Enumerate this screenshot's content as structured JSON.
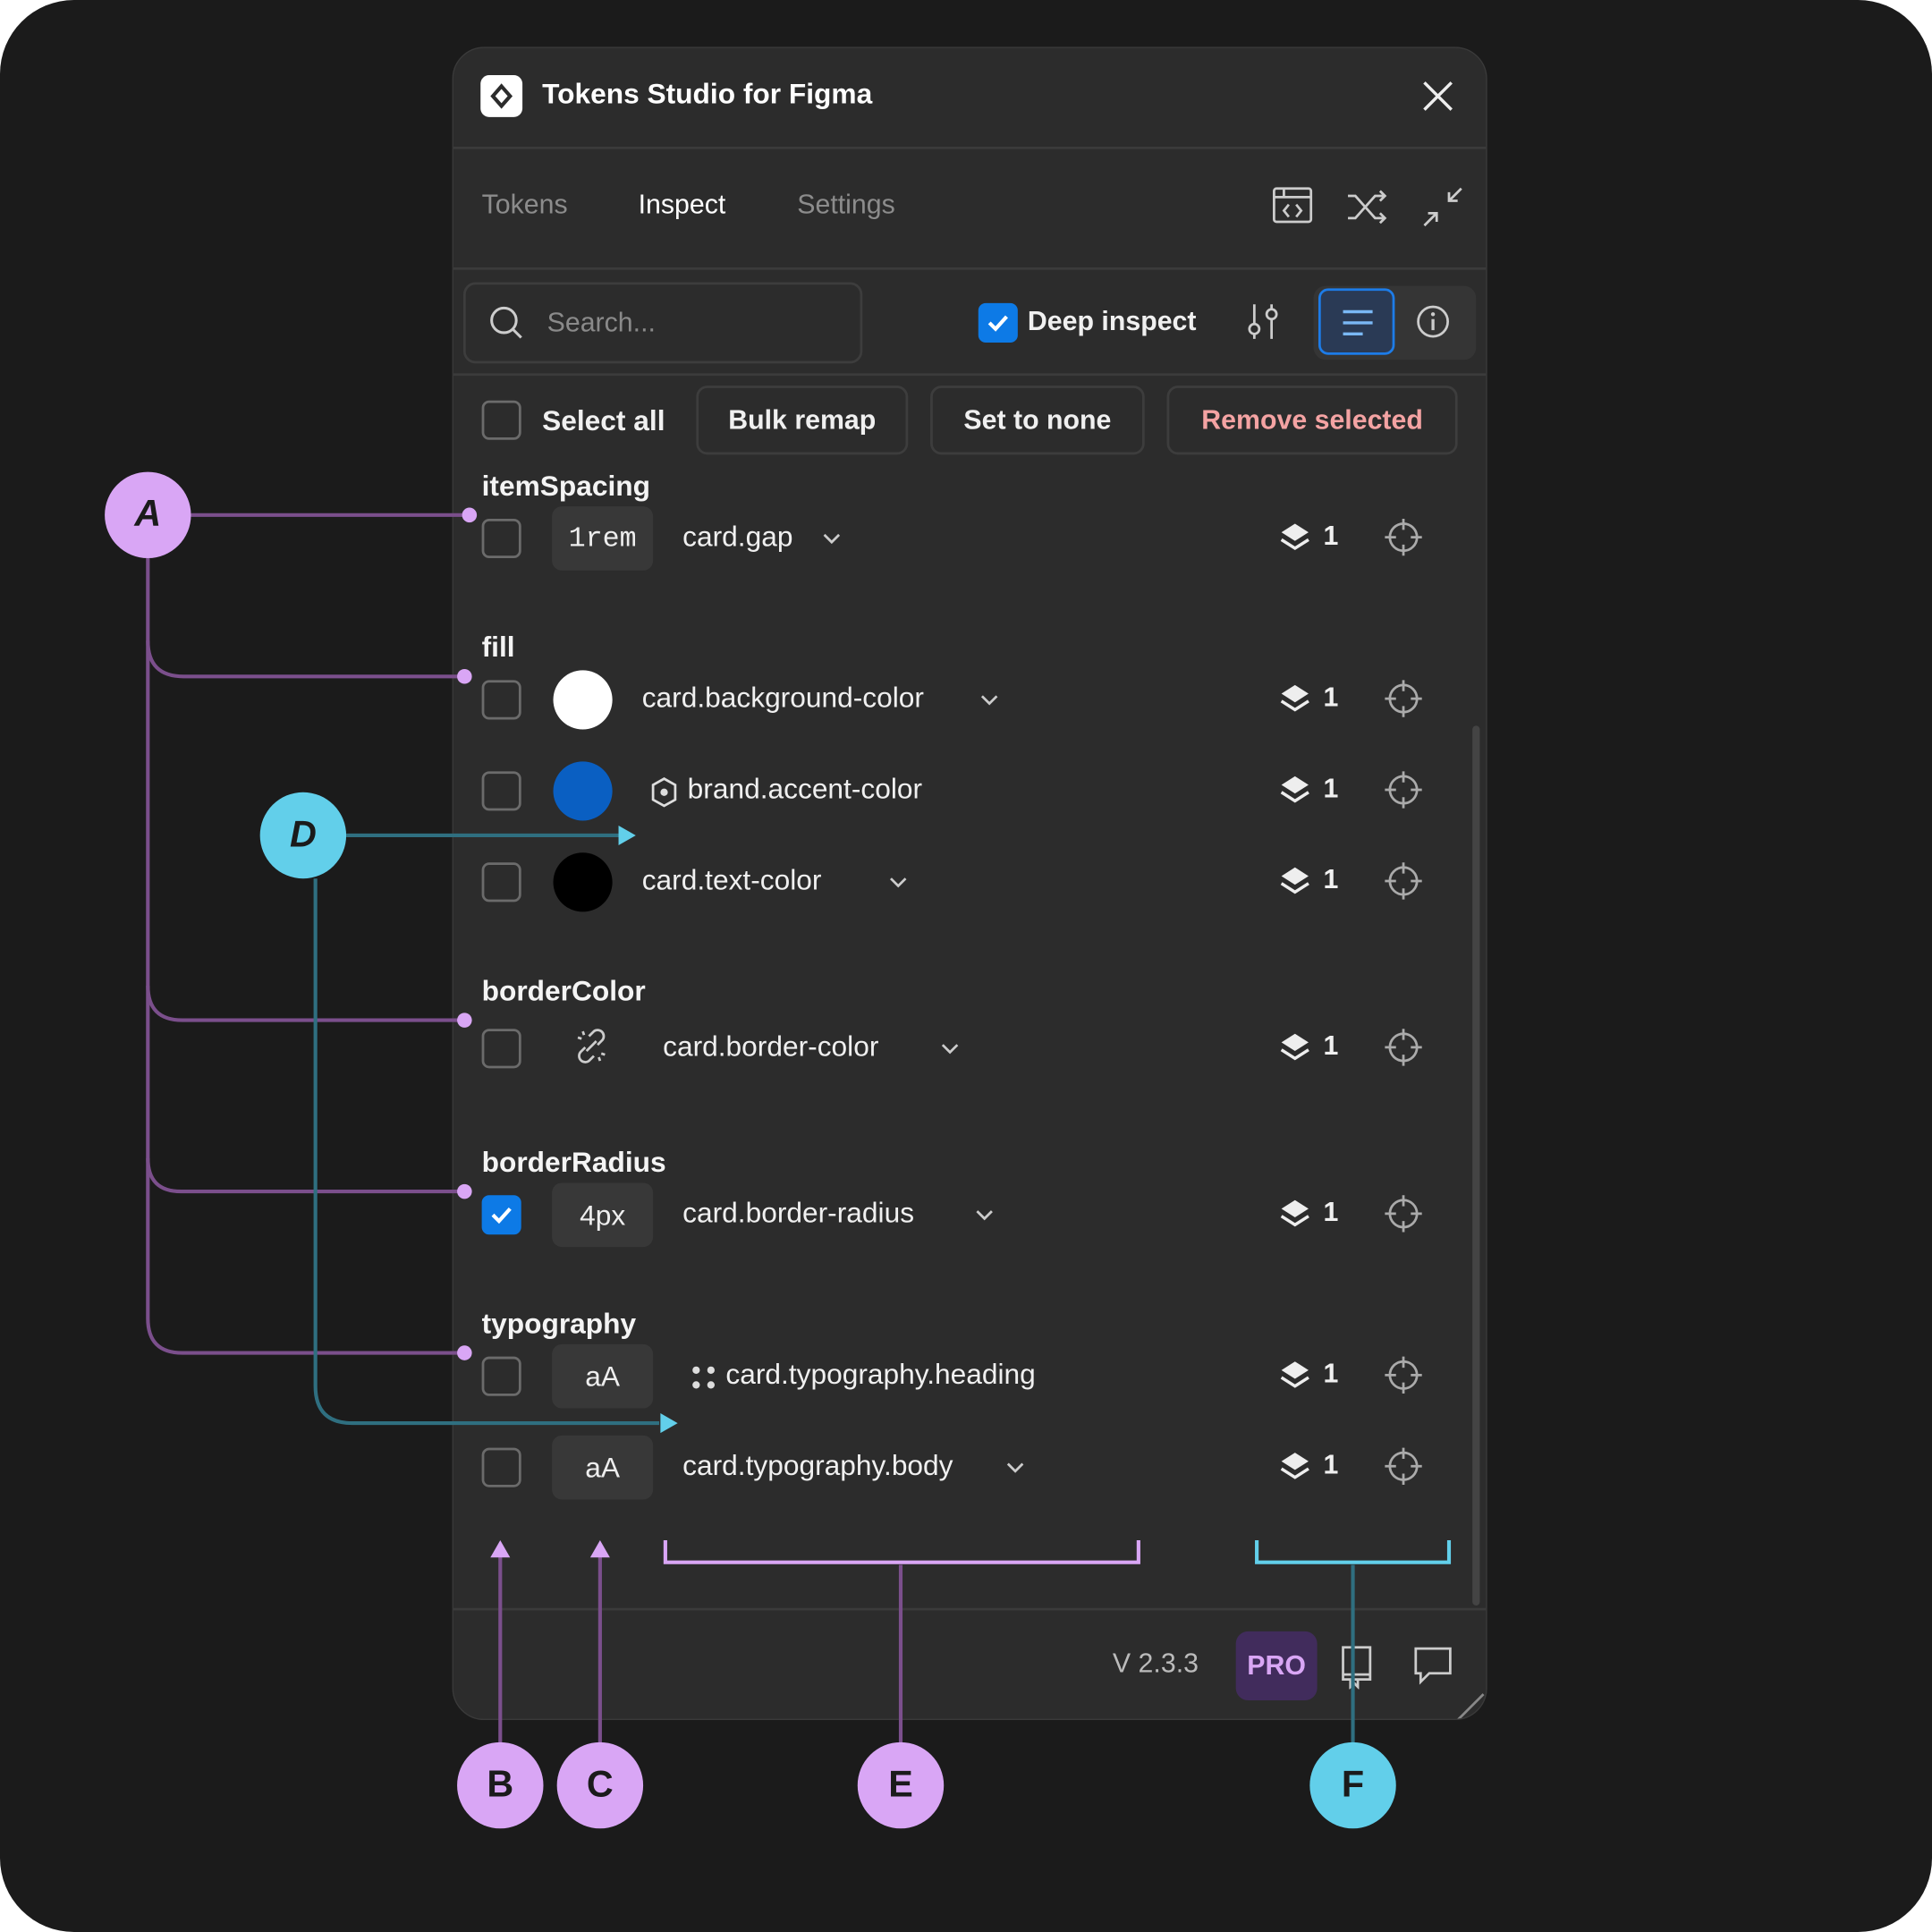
{
  "window": {
    "title": "Tokens Studio for Figma"
  },
  "tabs": [
    {
      "label": "Tokens"
    },
    {
      "label": "Inspect"
    },
    {
      "label": "Settings"
    }
  ],
  "toolbar": {
    "search_placeholder": "Search...",
    "deep_inspect_label": "Deep inspect",
    "deep_inspect_checked": true
  },
  "actions": {
    "select_all": "Select all",
    "bulk_remap": "Bulk remap",
    "set_to_none": "Set to none",
    "remove_selected": "Remove selected"
  },
  "groups": [
    {
      "name": "itemSpacing",
      "rows": [
        {
          "checked": false,
          "kind": "value",
          "value": "1rem",
          "mono": true,
          "token": "card.gap",
          "suffix": "chevron",
          "layers": "1"
        }
      ]
    },
    {
      "name": "fill",
      "rows": [
        {
          "checked": false,
          "kind": "color",
          "color": "#ffffff",
          "token": "card.background-color",
          "suffix": "chevron",
          "layers": "1"
        },
        {
          "checked": false,
          "kind": "color",
          "color": "#0a5fc2",
          "token": "brand.accent-color",
          "prefix": "hexagon",
          "layers": "1"
        },
        {
          "checked": false,
          "kind": "color",
          "color": "#000000",
          "token": "card.text-color",
          "suffix": "chevron",
          "layers": "1"
        }
      ]
    },
    {
      "name": "borderColor",
      "rows": [
        {
          "checked": false,
          "kind": "broken-link",
          "token": "card.border-color",
          "suffix": "chevron",
          "layers": "1"
        }
      ]
    },
    {
      "name": "borderRadius",
      "rows": [
        {
          "checked": true,
          "kind": "value",
          "value": "4px",
          "token": "card.border-radius",
          "suffix": "chevron",
          "layers": "1"
        }
      ]
    },
    {
      "name": "typography",
      "rows": [
        {
          "checked": false,
          "kind": "value",
          "value": "aA",
          "token": "card.typography.heading",
          "prefix": "dots",
          "layers": "1"
        },
        {
          "checked": false,
          "kind": "value",
          "value": "aA",
          "token": "card.typography.body",
          "suffix": "chevron",
          "layers": "1"
        }
      ]
    }
  ],
  "footer": {
    "version": "V 2.3.3",
    "pro": "PRO"
  },
  "annotations": {
    "A": "A",
    "B": "B",
    "C": "C",
    "D": "D",
    "E": "E",
    "F": "F"
  },
  "colors": {
    "accent": "#0d7ae6",
    "danger": "#f4a3a3",
    "annot_purple": "#d9a6f5",
    "annot_cyan": "#62cfea",
    "pro_bg": "#412c5c"
  }
}
